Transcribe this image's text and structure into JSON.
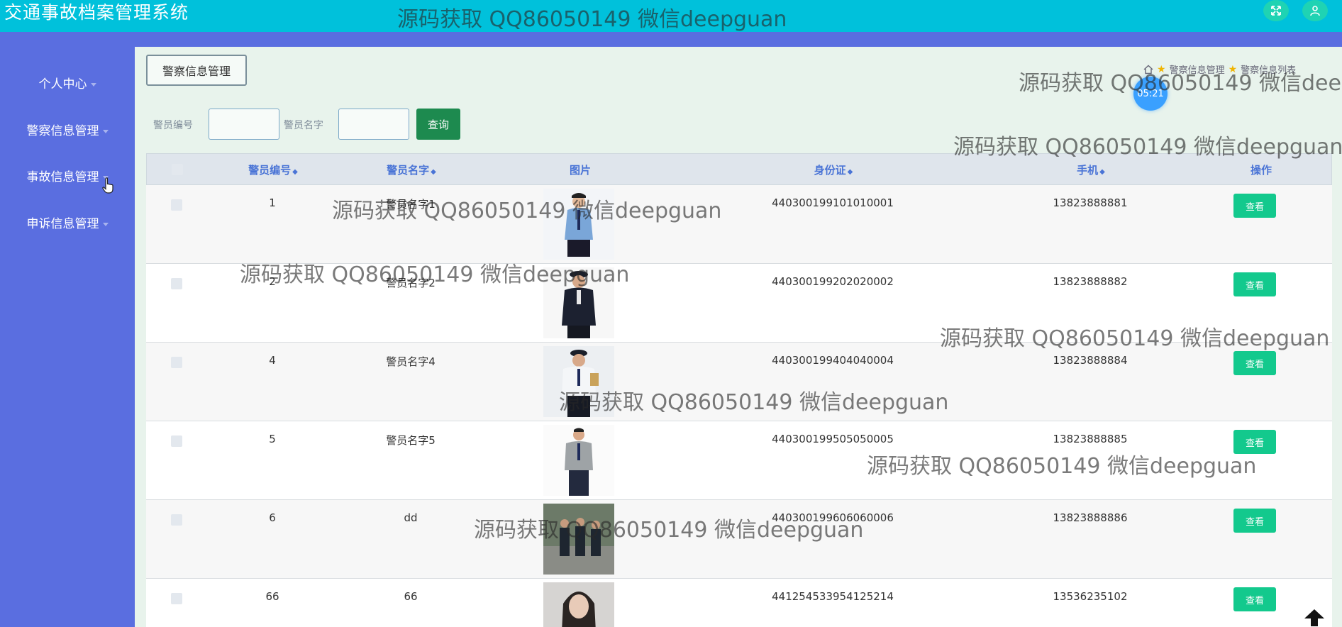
{
  "app": {
    "title": "交通事故档案管理系统"
  },
  "sidebar": {
    "items": [
      {
        "label": "个人中心"
      },
      {
        "label": "警察信息管理"
      },
      {
        "label": "事故信息管理"
      },
      {
        "label": "申诉信息管理"
      }
    ]
  },
  "page": {
    "tag_label": "警察信息管理"
  },
  "breadcrumb": {
    "items": [
      "警察信息管理",
      "警察信息列表"
    ]
  },
  "timer": {
    "text": "05:21"
  },
  "search": {
    "id_label": "警员编号",
    "name_label": "警员名字",
    "id_value": "",
    "name_value": "",
    "button_label": "查询"
  },
  "table": {
    "headers": {
      "id": "警员编号",
      "name": "警员名字",
      "photo": "图片",
      "idcard": "身份证",
      "phone": "手机",
      "action": "操作"
    },
    "rows": [
      {
        "id": "1",
        "name": "警员名字1",
        "idcard": "440300199101010001",
        "phone": "13823888881",
        "action": "查看"
      },
      {
        "id": "2",
        "name": "警员名字2",
        "idcard": "440300199202020002",
        "phone": "13823888882",
        "action": "查看"
      },
      {
        "id": "4",
        "name": "警员名字4",
        "idcard": "440300199404040004",
        "phone": "13823888884",
        "action": "查看"
      },
      {
        "id": "5",
        "name": "警员名字5",
        "idcard": "440300199505050005",
        "phone": "13823888885",
        "action": "查看"
      },
      {
        "id": "6",
        "name": "dd",
        "idcard": "440300199606060006",
        "phone": "13823888886",
        "action": "查看"
      },
      {
        "id": "66",
        "name": "66",
        "idcard": "441254533954125214",
        "phone": "13536235102",
        "action": "查看"
      }
    ]
  },
  "watermark": {
    "text": "源码获取 QQ86050149 微信deepguan"
  },
  "colors": {
    "topbar": "#00c1db",
    "sidebar": "#5a6ee0",
    "content_bg": "#e8f3ec",
    "header_text": "#4a74d6",
    "view_button": "#13c98d",
    "query_button": "#1d8a4f"
  }
}
